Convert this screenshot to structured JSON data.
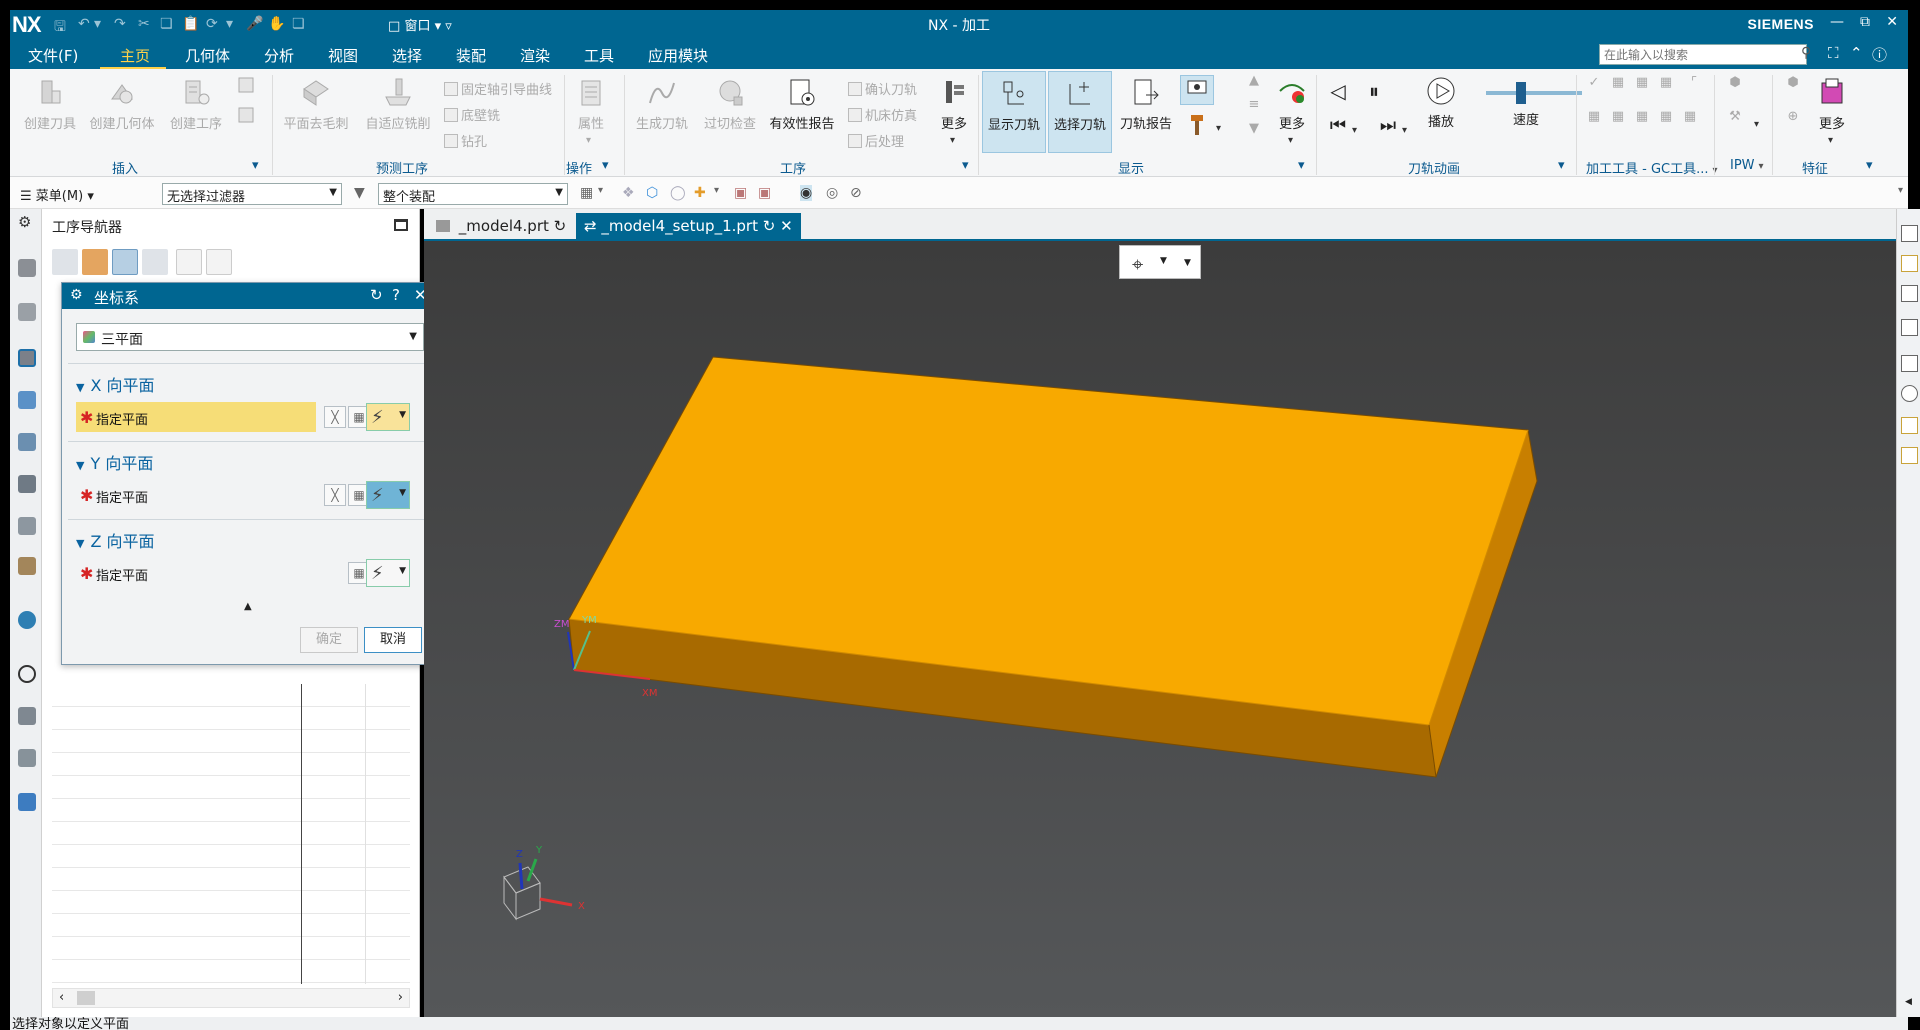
{
  "titlebar": {
    "logo": "NX",
    "window_menu": "窗口",
    "title": "NX - 加工",
    "brand": "SIEMENS"
  },
  "menubar": {
    "items": [
      "文件(F)",
      "主页",
      "几何体",
      "分析",
      "视图",
      "选择",
      "装配",
      "渲染",
      "工具",
      "应用模块"
    ],
    "active_item": "主页",
    "search_placeholder": "在此输入以搜索"
  },
  "ribbon": {
    "insert": {
      "buttons": [
        "创建刀具",
        "创建几何体",
        "创建工序"
      ],
      "group_label": "插入"
    },
    "predict": {
      "buttons": [
        "平面去毛刺",
        "自适应铣削"
      ],
      "small": [
        "固定轴引导曲线",
        "底壁铣",
        "钻孔"
      ],
      "group_label": "预测工序"
    },
    "ops": {
      "buttons": [
        "属性"
      ],
      "group_label": "操作"
    },
    "process": {
      "buttons": [
        "生成刀轨",
        "过切检查",
        "有效性报告"
      ],
      "small": [
        "确认刀轨",
        "机床仿真",
        "后处理"
      ],
      "more": "更多",
      "group_label": "工序"
    },
    "display": {
      "buttons": [
        "显示刀轨",
        "选择刀轨",
        "刀轨报告"
      ],
      "more": "更多",
      "group_label": "显示"
    },
    "animation": {
      "play": "播放",
      "speed": "速度",
      "speed_level": 0.35,
      "group_label": "刀轨动画"
    },
    "tools": {
      "group_label": "加工工具 - GC工具...",
      "ipw_label": "IPW",
      "feature_label": "特征",
      "more": "更多"
    }
  },
  "filterbar": {
    "menu_label": "菜单(M)",
    "filter_value": "无选择过滤器",
    "scope_value": "整个装配"
  },
  "navigator": {
    "title": "工序导航器"
  },
  "dialog": {
    "title": "坐标系",
    "type_value": "三平面",
    "sections": [
      {
        "header": "X 向平面",
        "row_label": "指定平面"
      },
      {
        "header": "Y 向平面",
        "row_label": "指定平面"
      },
      {
        "header": "Z 向平面",
        "row_label": "指定平面"
      }
    ],
    "ok_label": "确定",
    "cancel_label": "取消"
  },
  "tabs": [
    {
      "label": "_model4.prt",
      "active": false
    },
    {
      "label": "_model4_setup_1.prt",
      "active": true
    }
  ],
  "viewport": {
    "part_color": "#f8a900",
    "csys_labels": {
      "zm": "ZM",
      "ym": "YM",
      "xm": "XM"
    },
    "triad_labels": {
      "x": "X",
      "y": "Y",
      "z": "Z"
    }
  },
  "statusbar": {
    "message": "选择对象以定义平面"
  },
  "colors": {
    "nx_blue": "#006691",
    "active_tab_yellow": "#ffd24a",
    "highlight_row": "#f6dd77"
  }
}
